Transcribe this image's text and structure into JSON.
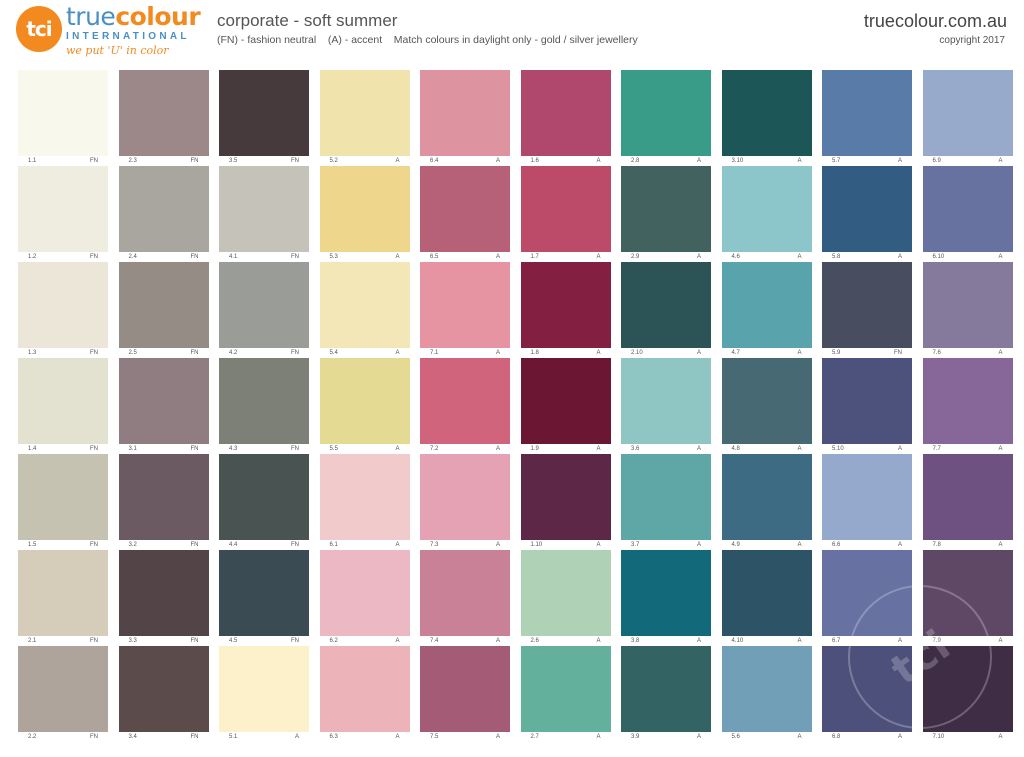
{
  "header": {
    "logo_mark": "tci",
    "brand_true": "true",
    "brand_colour": "colour",
    "brand_sub": "INTERNATIONAL",
    "brand_tag": "we put 'U' in color",
    "title": "corporate - soft summer",
    "subtitle": "(FN) - fashion neutral    (A) - accent    Match colours in daylight only - gold / silver jewellery",
    "site": "truecolour.com.au",
    "copyright": "copyright 2017"
  },
  "watermark": "tci",
  "columns": [
    [
      {
        "code": "1.1",
        "type": "FN",
        "color": "#f8f8ec"
      },
      {
        "code": "1.2",
        "type": "FN",
        "color": "#eeeddf"
      },
      {
        "code": "1.3",
        "type": "FN",
        "color": "#ece6d8"
      },
      {
        "code": "1.4",
        "type": "FN",
        "color": "#e3e1d0"
      },
      {
        "code": "1.5",
        "type": "FN",
        "color": "#c6c2b1"
      },
      {
        "code": "2.1",
        "type": "FN",
        "color": "#d6ccba"
      },
      {
        "code": "2.2",
        "type": "FN",
        "color": "#aea49c"
      }
    ],
    [
      {
        "code": "2.3",
        "type": "FN",
        "color": "#9c8888"
      },
      {
        "code": "2.4",
        "type": "FN",
        "color": "#a8a69f"
      },
      {
        "code": "2.5",
        "type": "FN",
        "color": "#958c86"
      },
      {
        "code": "3.1",
        "type": "FN",
        "color": "#8f7d82"
      },
      {
        "code": "3.2",
        "type": "FN",
        "color": "#6c5a63"
      },
      {
        "code": "3.3",
        "type": "FN",
        "color": "#534447"
      },
      {
        "code": "3.4",
        "type": "FN",
        "color": "#5c4b4b"
      }
    ],
    [
      {
        "code": "3.5",
        "type": "FN",
        "color": "#463a3c"
      },
      {
        "code": "4.1",
        "type": "FN",
        "color": "#c5c2ba"
      },
      {
        "code": "4.2",
        "type": "FN",
        "color": "#9a9d97"
      },
      {
        "code": "4.3",
        "type": "FN",
        "color": "#7c8077"
      },
      {
        "code": "4.4",
        "type": "FN",
        "color": "#495452"
      },
      {
        "code": "4.5",
        "type": "FN",
        "color": "#3b4b53"
      },
      {
        "code": "5.1",
        "type": "A",
        "color": "#fcf1cb"
      }
    ],
    [
      {
        "code": "5.2",
        "type": "A",
        "color": "#f1e3ac"
      },
      {
        "code": "5.3",
        "type": "A",
        "color": "#efd68d"
      },
      {
        "code": "5.4",
        "type": "A",
        "color": "#f3e7b7"
      },
      {
        "code": "5.5",
        "type": "A",
        "color": "#e4da93"
      },
      {
        "code": "6.1",
        "type": "A",
        "color": "#f1cbcb"
      },
      {
        "code": "6.2",
        "type": "A",
        "color": "#ecb8c4"
      },
      {
        "code": "6.3",
        "type": "A",
        "color": "#ecb4b8"
      }
    ],
    [
      {
        "code": "6.4",
        "type": "A",
        "color": "#dd94a0"
      },
      {
        "code": "6.5",
        "type": "A",
        "color": "#b66178"
      },
      {
        "code": "7.1",
        "type": "A",
        "color": "#e693a2"
      },
      {
        "code": "7.2",
        "type": "A",
        "color": "#cf647c"
      },
      {
        "code": "7.3",
        "type": "A",
        "color": "#e5a2b4"
      },
      {
        "code": "7.4",
        "type": "A",
        "color": "#c88196"
      },
      {
        "code": "7.5",
        "type": "A",
        "color": "#a45c76"
      }
    ],
    [
      {
        "code": "1.6",
        "type": "A",
        "color": "#b0486e"
      },
      {
        "code": "1.7",
        "type": "A",
        "color": "#bc4b6a"
      },
      {
        "code": "1.8",
        "type": "A",
        "color": "#831f40"
      },
      {
        "code": "1.9",
        "type": "A",
        "color": "#6b1633"
      },
      {
        "code": "1.10",
        "type": "A",
        "color": "#5d2748"
      },
      {
        "code": "2.6",
        "type": "A",
        "color": "#afd1b5"
      },
      {
        "code": "2.7",
        "type": "A",
        "color": "#63b09c"
      }
    ],
    [
      {
        "code": "2.8",
        "type": "A",
        "color": "#389c88"
      },
      {
        "code": "2.9",
        "type": "A",
        "color": "#426260"
      },
      {
        "code": "2.10",
        "type": "A",
        "color": "#2c5356"
      },
      {
        "code": "3.6",
        "type": "A",
        "color": "#8fc6c4"
      },
      {
        "code": "3.7",
        "type": "A",
        "color": "#5ea7a6"
      },
      {
        "code": "3.8",
        "type": "A",
        "color": "#11697a"
      },
      {
        "code": "3.9",
        "type": "A",
        "color": "#346363"
      }
    ],
    [
      {
        "code": "3.10",
        "type": "A",
        "color": "#1c5656"
      },
      {
        "code": "4.6",
        "type": "A",
        "color": "#8dc6ca"
      },
      {
        "code": "4.7",
        "type": "A",
        "color": "#58a3ac"
      },
      {
        "code": "4.8",
        "type": "A",
        "color": "#476973"
      },
      {
        "code": "4.9",
        "type": "A",
        "color": "#3e6b84"
      },
      {
        "code": "4.10",
        "type": "A",
        "color": "#2d5367"
      },
      {
        "code": "5.6",
        "type": "A",
        "color": "#709fb7"
      }
    ],
    [
      {
        "code": "5.7",
        "type": "A",
        "color": "#587ba7"
      },
      {
        "code": "5.8",
        "type": "A",
        "color": "#325c82"
      },
      {
        "code": "5.9",
        "type": "FN",
        "color": "#484e5f"
      },
      {
        "code": "5.10",
        "type": "A",
        "color": "#4c527b"
      },
      {
        "code": "6.6",
        "type": "A",
        "color": "#95a9cc"
      },
      {
        "code": "6.7",
        "type": "A",
        "color": "#6771a2"
      },
      {
        "code": "6.8",
        "type": "A",
        "color": "#4d507a"
      }
    ],
    [
      {
        "code": "6.9",
        "type": "A",
        "color": "#97aacb"
      },
      {
        "code": "6.10",
        "type": "A",
        "color": "#6772a0"
      },
      {
        "code": "7.6",
        "type": "A",
        "color": "#867a9c"
      },
      {
        "code": "7.7",
        "type": "A",
        "color": "#876799"
      },
      {
        "code": "7.8",
        "type": "A",
        "color": "#6e5180"
      },
      {
        "code": "7.9",
        "type": "A",
        "color": "#5e4865"
      },
      {
        "code": "7.10",
        "type": "A",
        "color": "#3e2d45"
      }
    ]
  ]
}
